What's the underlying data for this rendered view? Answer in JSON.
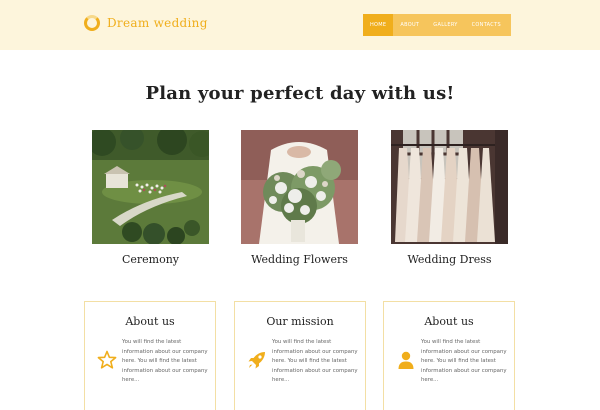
{
  "brand": {
    "name": "Dream wedding",
    "accent": "#f0ae1c"
  },
  "nav": {
    "items": [
      {
        "label": "Home",
        "active": true
      },
      {
        "label": "About",
        "active": false
      },
      {
        "label": "Gallery",
        "active": false
      },
      {
        "label": "Contacts",
        "active": false
      }
    ]
  },
  "main": {
    "headline": "Plan your perfect day with us!",
    "gallery": [
      {
        "caption": "Ceremony"
      },
      {
        "caption": "Wedding Flowers"
      },
      {
        "caption": "Wedding Dress"
      }
    ],
    "cards": [
      {
        "title": "About us",
        "icon": "star-icon",
        "text": "You will find the latest information about our company here. You will find the latest information about our company here..."
      },
      {
        "title": "Our mission",
        "icon": "rocket-icon",
        "text": "You will find the latest information about our company here. You will find the latest information about our company here..."
      },
      {
        "title": "About us",
        "icon": "user-icon",
        "text": "You will find the latest information about our company here. You will find the latest information about our company here..."
      }
    ]
  }
}
